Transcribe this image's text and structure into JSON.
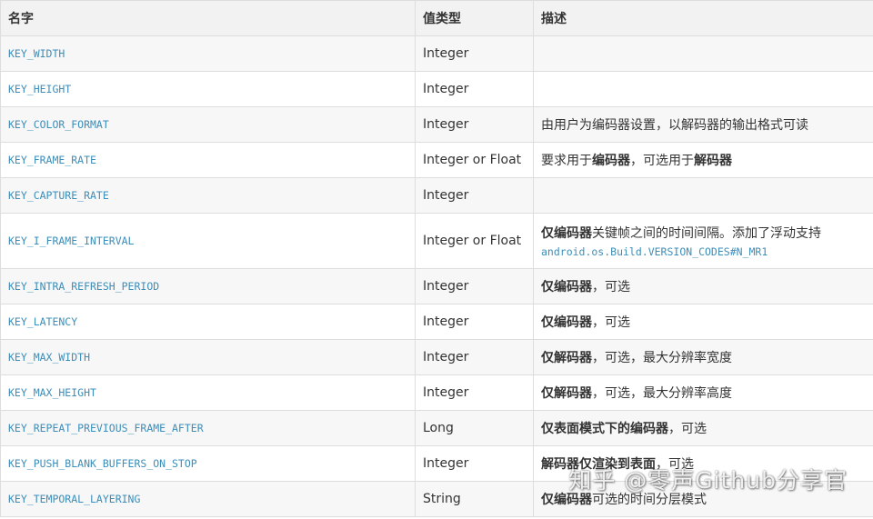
{
  "table": {
    "headers": [
      "名字",
      "值类型",
      "描述"
    ],
    "rows": [
      {
        "key": "KEY_WIDTH",
        "type": "Integer",
        "desc": []
      },
      {
        "key": "KEY_HEIGHT",
        "type": "Integer",
        "desc": []
      },
      {
        "key": "KEY_COLOR_FORMAT",
        "type": "Integer",
        "desc": [
          {
            "t": "由用户为编码器设置，以解码器的输出格式可读"
          }
        ]
      },
      {
        "key": "KEY_FRAME_RATE",
        "type": "Integer or Float",
        "desc": [
          {
            "t": "要求用于"
          },
          {
            "t": "编码器",
            "b": true
          },
          {
            "t": "，可选用于"
          },
          {
            "t": "解码器",
            "b": true
          }
        ]
      },
      {
        "key": "KEY_CAPTURE_RATE",
        "type": "Integer",
        "desc": []
      },
      {
        "key": "KEY_I_FRAME_INTERVAL",
        "type": "Integer or Float",
        "tall": true,
        "desc": [
          {
            "t": "仅编码器",
            "b": true
          },
          {
            "t": "关键帧之间的时间间隔。添加了浮动支持"
          },
          {
            "br": true
          },
          {
            "t": "android.os.Build.VERSION_CODES#N_MR1",
            "code": true
          }
        ]
      },
      {
        "key": "KEY_INTRA_REFRESH_PERIOD",
        "type": "Integer",
        "desc": [
          {
            "t": "仅编码器",
            "b": true
          },
          {
            "t": "，可选"
          }
        ]
      },
      {
        "key": "KEY_LATENCY",
        "type": "Integer",
        "desc": [
          {
            "t": "仅编码器",
            "b": true
          },
          {
            "t": "，可选"
          }
        ]
      },
      {
        "key": "KEY_MAX_WIDTH",
        "type": "Integer",
        "desc": [
          {
            "t": "仅解码器",
            "b": true
          },
          {
            "t": "，可选，最大分辨率宽度"
          }
        ]
      },
      {
        "key": "KEY_MAX_HEIGHT",
        "type": "Integer",
        "desc": [
          {
            "t": "仅解码器",
            "b": true
          },
          {
            "t": "，可选，最大分辨率高度"
          }
        ]
      },
      {
        "key": "KEY_REPEAT_PREVIOUS_FRAME_AFTER",
        "type": "Long",
        "desc": [
          {
            "t": "仅表面模式下的编码器",
            "b": true
          },
          {
            "t": "，可选"
          }
        ]
      },
      {
        "key": "KEY_PUSH_BLANK_BUFFERS_ON_STOP",
        "type": "Integer",
        "desc": [
          {
            "t": "解码器仅渲染到表面",
            "b": true
          },
          {
            "t": "，可选"
          }
        ]
      },
      {
        "key": "KEY_TEMPORAL_LAYERING",
        "type": "String",
        "desc": [
          {
            "t": "仅编码器",
            "b": true
          },
          {
            "t": "可选的时间分层模式"
          }
        ]
      }
    ]
  },
  "watermark": "知乎 @零声Github分享官",
  "colors": {
    "key_text": "#3d8eb9",
    "border": "#dddddd",
    "header_bg": "#f2f2f2",
    "stripe_bg": "#f7f7f7"
  }
}
